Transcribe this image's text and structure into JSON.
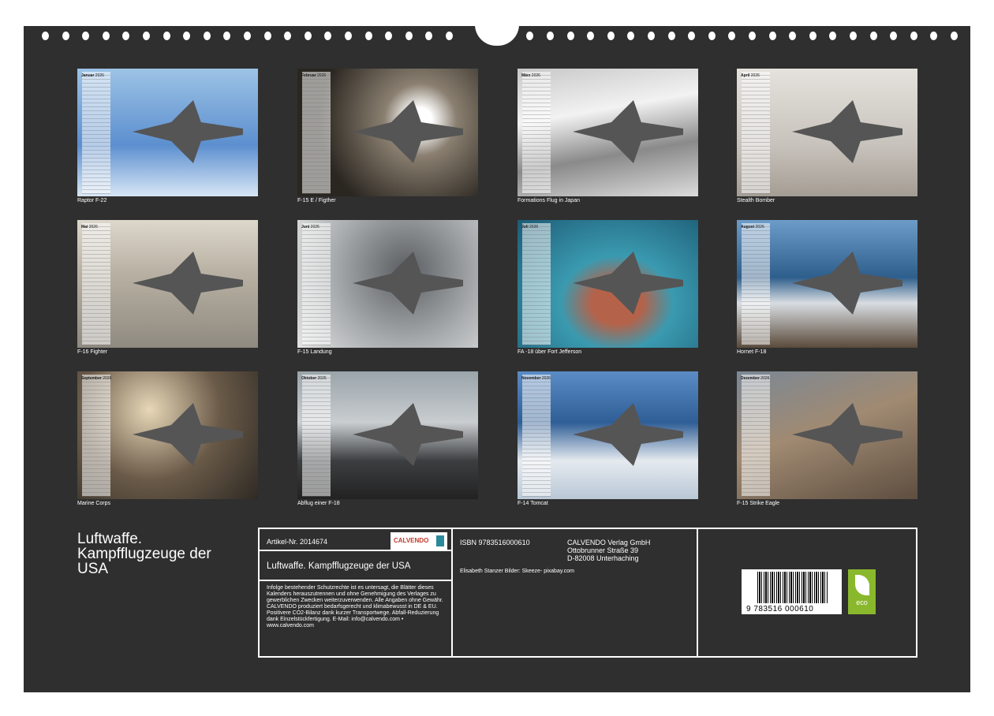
{
  "calendar": {
    "year": "2026",
    "months": [
      {
        "month": "Januar",
        "caption": "Raptor F-22",
        "bg": "linear-gradient(180deg,#9dc3e6,#5c8fcf 60%,#d8e6f5)"
      },
      {
        "month": "Februar",
        "caption": "F-15 E / Figther",
        "bg": "radial-gradient(circle at 68% 40%,#fff 0 8%,#8a7f70 25%,#2a2620 70%)"
      },
      {
        "month": "März",
        "caption": "Formations Flug in Japan",
        "bg": "linear-gradient(170deg,#c8c8c8,#f2f2f2 35%,#8a8a8a 65%,#dcdcdc)"
      },
      {
        "month": "April",
        "caption": "Stealth Bomber",
        "bg": "linear-gradient(180deg,#e5e2dd,#c7c2bb 60%,#a49d94)"
      },
      {
        "month": "Mai",
        "caption": "F-16 Fighter",
        "bg": "linear-gradient(180deg,#ddd7cc,#b9b2a4 40%,#8f8a80)"
      },
      {
        "month": "Juni",
        "caption": "F-15 Landung",
        "bg": "radial-gradient(circle at 60% 40%,#5a5e62,#a8acae 55%,#e4e4e4)"
      },
      {
        "month": "Juli",
        "caption": "FA -18 über Fort Jefferson",
        "bg": "radial-gradient(ellipse at 55% 65%,#b5624a 0 18%,#3a9ab0 40%,#1d5b75)"
      },
      {
        "month": "August",
        "caption": "Hornet F-18",
        "bg": "linear-gradient(180deg,#6d9cc9,#2e5e8c 45%,#d8dde2 65%,#5a4a3a)"
      },
      {
        "month": "September",
        "caption": "Marine Corps",
        "bg": "radial-gradient(circle at 40% 30%,#e8d8b8,#6a5a48 50%,#2e2a24)"
      },
      {
        "month": "Oktober",
        "caption": "Abflug einer F-18",
        "bg": "linear-gradient(180deg,#9aa4aa,#c9cdd0 40%,#3c3e40 70%,#222)"
      },
      {
        "month": "November",
        "caption": "F-14 Tomcat",
        "bg": "linear-gradient(180deg,#5b8cc5,#2f5e96 40%,#e5eaef 70%,#b9c7d6)"
      },
      {
        "month": "Dezember",
        "caption": "F-15 Strike Eagle",
        "bg": "linear-gradient(160deg,#7b8896,#a08a72 45%,#5e4e40)"
      }
    ]
  },
  "title": "Luftwaffe. Kampfflugzeuge der USA",
  "info": {
    "article": "Artikel-Nr. 2014674",
    "logo": "CALVENDO",
    "product_title": "Luftwaffe. Kampfflugzeuge der USA",
    "legal": "Infolge bestehender Schutzrechte ist es untersagt, die Blätter dieses Kalenders herauszutrennen und ohne Genehmigung des Verlages zu gewerblichen Zwecken weiterzuverwenden. Alle Angaben ohne Gewähr. CALVENDO produziert bedarfsgerecht und klimabewusst in DE & EU. Positivere CO2-Bilanz dank kurzer Transportwege. Abfall-Reduzierung dank Einzelstückfertigung. E-Mail: info@calvendo.com • www.calvendo.com",
    "isbn": "ISBN 9783516000610",
    "publisher": [
      "CALVENDO Verlag GmbH",
      "Ottobrunner Straße 39",
      "D-82008 Unterhaching"
    ],
    "credits": "Elisabeth Stanzer Bilder: Skeeze- pixabay.com",
    "barcode": "9  783516  000610",
    "eco": "eco"
  }
}
